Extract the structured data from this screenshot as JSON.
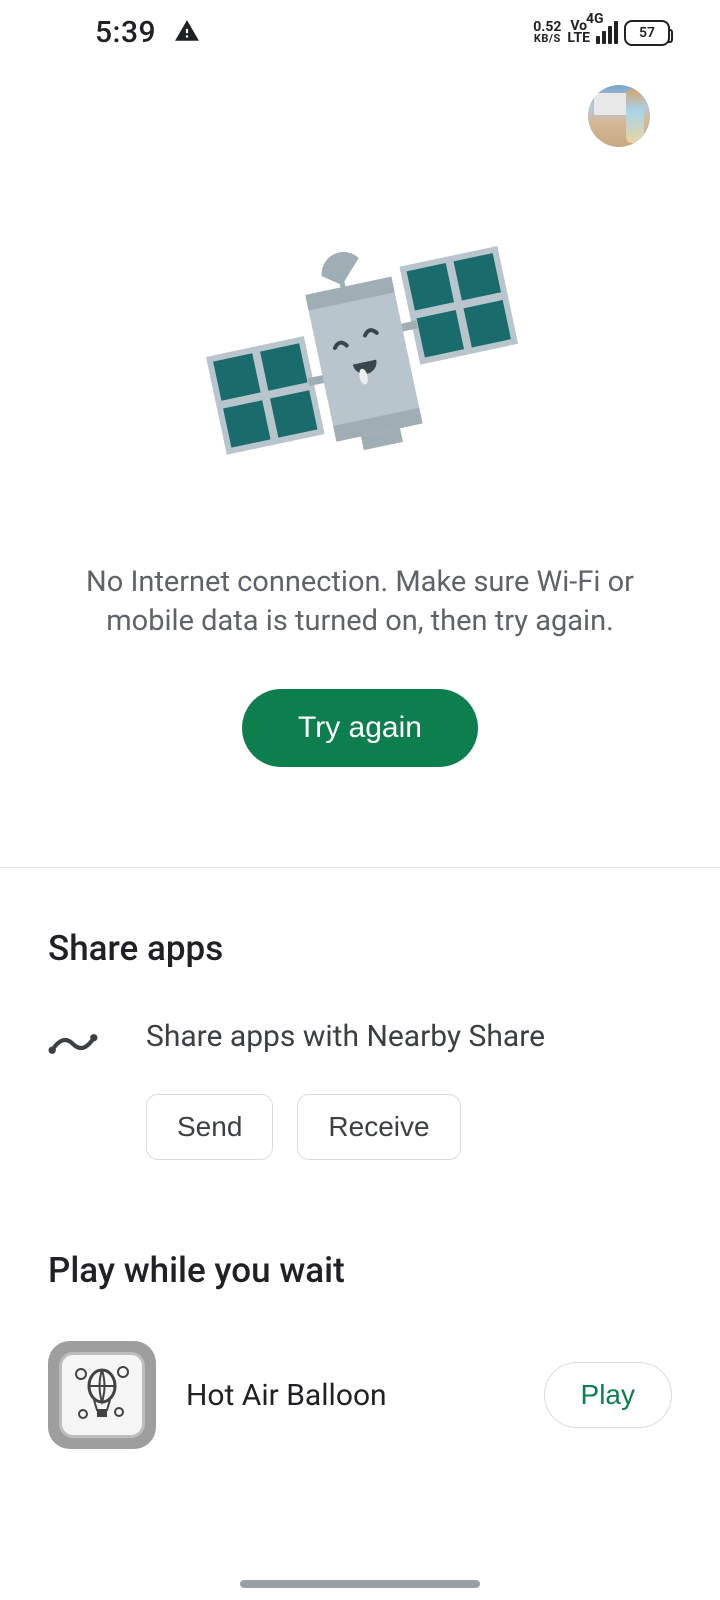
{
  "status": {
    "time": "5:39",
    "net_speed_value": "0.52",
    "net_speed_unit": "KB/S",
    "volte_top": "Vo",
    "volte_bot": "LTE",
    "signal_label": "4G",
    "battery": "57"
  },
  "error": {
    "message": "No Internet connection. Make sure Wi-Fi or mobile data is turned on, then try again.",
    "retry_label": "Try again"
  },
  "share": {
    "title": "Share apps",
    "subtitle": "Share apps with Nearby Share",
    "send_label": "Send",
    "receive_label": "Receive"
  },
  "play": {
    "title": "Play while you wait",
    "game_name": "Hot Air Balloon",
    "play_label": "Play"
  }
}
